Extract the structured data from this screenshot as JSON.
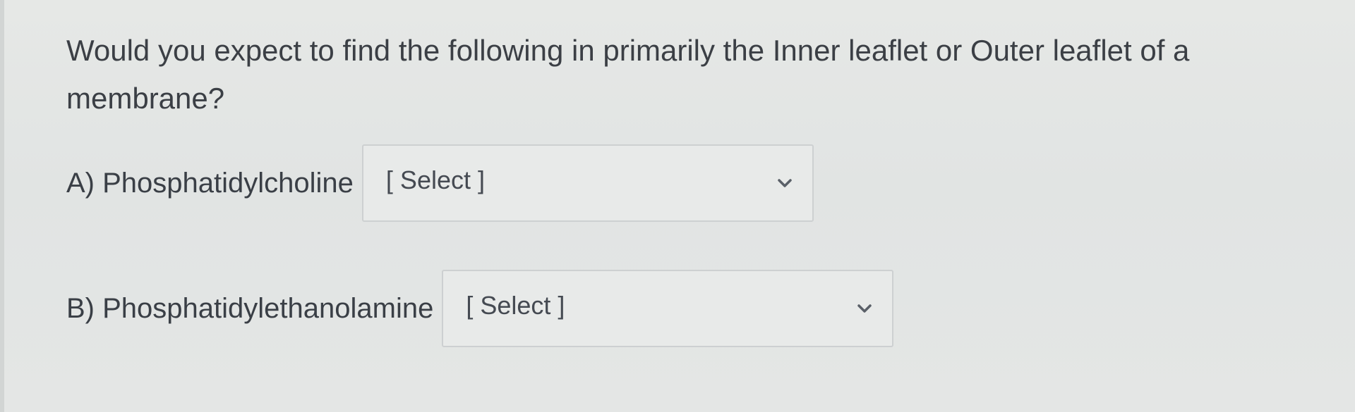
{
  "question": {
    "text": "Would you expect to find the following in primarily the Inner leaflet or Outer leaflet of a membrane?"
  },
  "items": [
    {
      "label": "A) Phosphatidylcholine",
      "selected": "[ Select ]"
    },
    {
      "label": "B) Phosphatidylethanolamine",
      "selected": "[ Select ]"
    }
  ],
  "icons": {
    "dropdown": "chevron-down-icon"
  },
  "colors": {
    "text": "#3a3f46",
    "select_border": "#cdd0d1",
    "background": "#e3e5e4"
  }
}
